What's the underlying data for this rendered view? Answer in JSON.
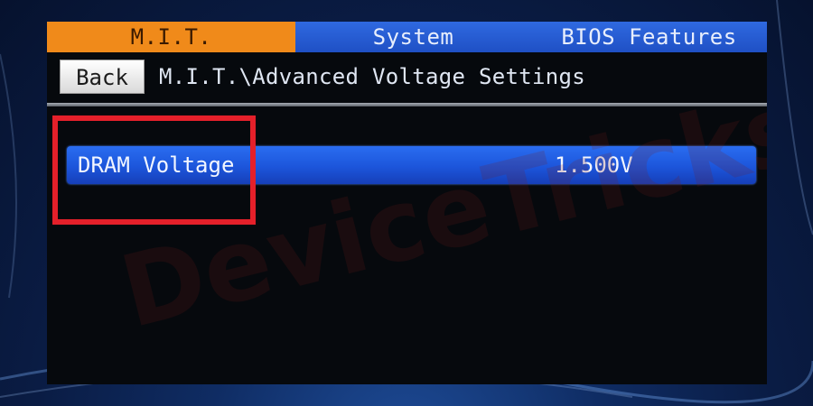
{
  "tabs": [
    {
      "label": "M.I.T.",
      "active": true
    },
    {
      "label": "System",
      "active": false
    },
    {
      "label": "BIOS Features",
      "active": false
    }
  ],
  "toolbar": {
    "back_label": "Back",
    "breadcrumb": "M.I.T.\\Advanced Voltage Settings"
  },
  "settings": [
    {
      "label": "DRAM Voltage",
      "value": "1.500V",
      "selected": true
    }
  ],
  "watermark": "DeviceTricks",
  "colors": {
    "active_tab": "#f08a1a",
    "inactive_tab": "#2a5fd8",
    "selection": "#1c55db",
    "highlight_box": "#e5202a",
    "screen_bg": "#06090d"
  }
}
